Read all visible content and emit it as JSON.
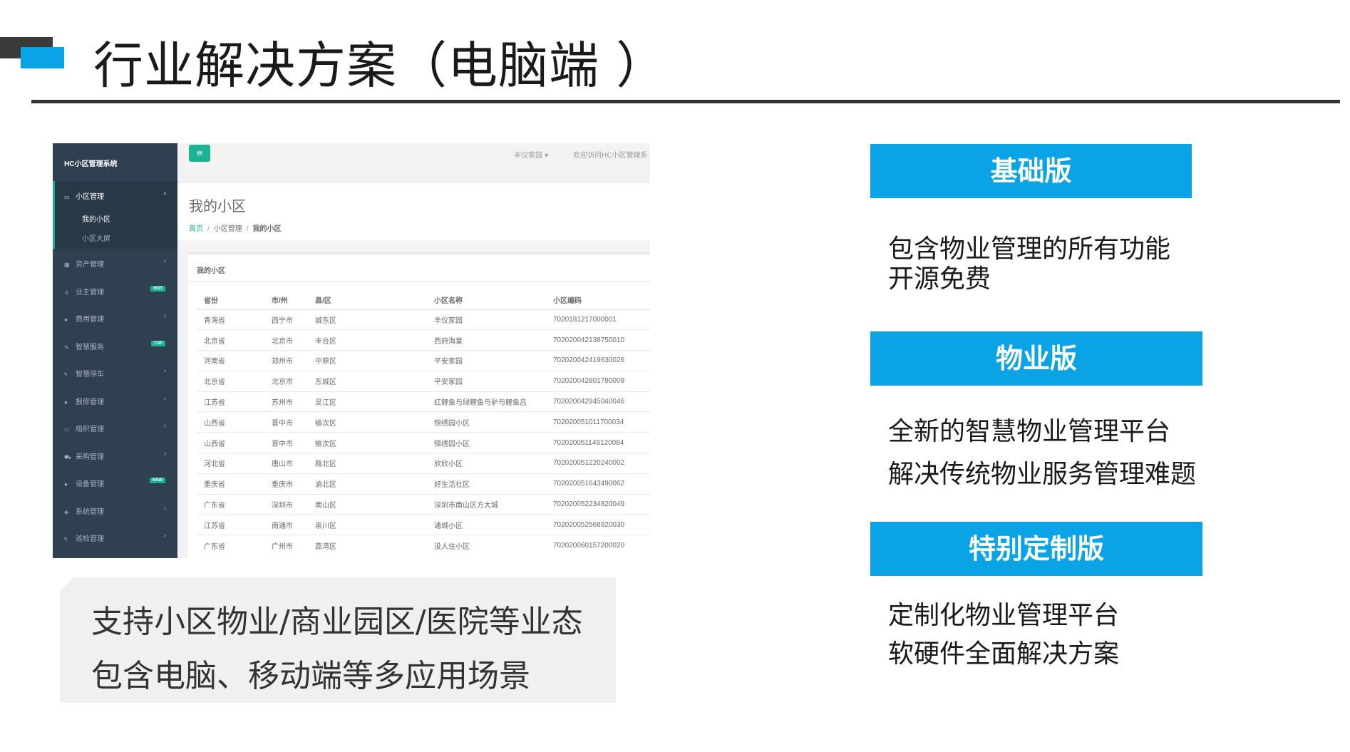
{
  "title": "行业解决方案（电脑端 ）",
  "screenshot": {
    "brand": "HC小区管理系统",
    "toggle_icon": "hamburger-icon",
    "user_menu": "丰仪家园 ▾",
    "welcome": "欢迎访问HC小区管理系",
    "active_menu": {
      "icon": "monitor-icon",
      "label": "小区管理",
      "subitems": [
        "我的小区",
        "小区大屏"
      ]
    },
    "menu": [
      {
        "icon": "grid-icon",
        "label": "资产管理",
        "badge": ""
      },
      {
        "icon": "person-icon",
        "label": "业主管理",
        "badge": "HOT"
      },
      {
        "icon": "circle-icon",
        "label": "费用管理",
        "badge": ""
      },
      {
        "icon": "edit-icon",
        "label": "智慧服务",
        "badge": "TOP"
      },
      {
        "icon": "bolt-icon",
        "label": "智慧停车",
        "badge": ""
      },
      {
        "icon": "circle-icon",
        "label": "报修管理",
        "badge": ""
      },
      {
        "icon": "monitor-icon",
        "label": "组织管理",
        "badge": ""
      },
      {
        "icon": "cart-icon",
        "label": "采购管理",
        "badge": ""
      },
      {
        "icon": "circle-icon",
        "label": "设备管理",
        "badge": "NEW"
      },
      {
        "icon": "gem-icon",
        "label": "系统管理",
        "badge": ""
      },
      {
        "icon": "bolt-icon",
        "label": "巡检管理",
        "badge": ""
      }
    ],
    "page_heading": "我的小区",
    "breadcrumb": [
      "首页",
      "小区管理",
      "我的小区"
    ],
    "box_title": "我的小区",
    "table": {
      "columns": [
        "省份",
        "市/州",
        "县/区",
        "小区名称",
        "小区编码"
      ],
      "rows": [
        [
          "青海省",
          "西宁市",
          "城东区",
          "丰仪家园",
          "7020181217000001"
        ],
        [
          "北京省",
          "北京市",
          "丰台区",
          "西府海棠",
          "702020042138750010"
        ],
        [
          "河南省",
          "郑州市",
          "中原区",
          "平安家园",
          "702020042419630026"
        ],
        [
          "北京省",
          "北京市",
          "东城区",
          "平安家园",
          "702020042801780008"
        ],
        [
          "江苏省",
          "苏州市",
          "吴江区",
          "红鲤鱼与绿鲤鱼与驴与鲤鱼吕",
          "702020042945040046"
        ],
        [
          "山西省",
          "晋中市",
          "榆次区",
          "锦绣园小区",
          "702020051011700034"
        ],
        [
          "山西省",
          "晋中市",
          "榆次区",
          "锦绣园小区",
          "702020051149120084"
        ],
        [
          "河北省",
          "唐山市",
          "路北区",
          "欣欣小区",
          "702020051220240002"
        ],
        [
          "重庆省",
          "重庆市",
          "渝北区",
          "好生活社区",
          "702020051643490062"
        ],
        [
          "广东省",
          "深圳市",
          "南山区",
          "深圳市南山区方大城",
          "702020052234820049"
        ],
        [
          "江苏省",
          "南通市",
          "崇川区",
          "通城小区",
          "702020052568920030"
        ],
        [
          "广东省",
          "广州市",
          "荔湾区",
          "没人住小区",
          "702020060157200020"
        ]
      ]
    }
  },
  "caption": [
    "支持小区物业/商业园区/医院等业态",
    "包含电脑、移动端等多应用场景"
  ],
  "editions": [
    {
      "name": "基础版",
      "lines": [
        "包含物业管理的所有功能",
        "开源免费"
      ]
    },
    {
      "name": "物业版",
      "lines": [
        "全新的智慧物业管理平台",
        "解决传统物业服务管理难题"
      ]
    },
    {
      "name": "特别定制版",
      "lines": [
        "定制化物业管理平台",
        "软硬件全面解决方案"
      ]
    }
  ],
  "colors": {
    "accent": "#0aa3e6",
    "sidebar": "#2f4050",
    "badge": "#1ab394"
  }
}
